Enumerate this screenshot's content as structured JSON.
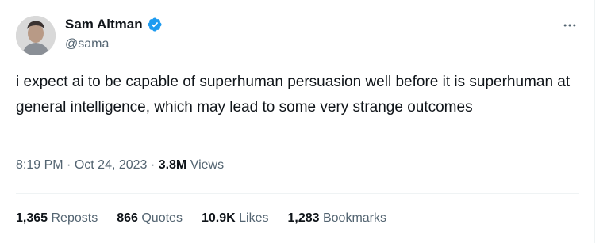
{
  "author": {
    "display_name": "Sam Altman",
    "handle": "@sama",
    "verified_color": "#1d9bf0"
  },
  "tweet": {
    "text": "i expect ai to be capable of superhuman persuasion well before it is superhuman at general intelligence, which may lead to some very strange outcomes",
    "time": "8:19 PM",
    "separator": "·",
    "date": "Oct 24, 2023",
    "views_count": "3.8M",
    "views_label": "Views"
  },
  "stats": {
    "reposts_count": "1,365",
    "reposts_label": "Reposts",
    "quotes_count": "866",
    "quotes_label": "Quotes",
    "likes_count": "10.9K",
    "likes_label": "Likes",
    "bookmarks_count": "1,283",
    "bookmarks_label": "Bookmarks"
  },
  "icons": {
    "more": "more-horizontal-icon",
    "verified": "verified-badge-icon"
  }
}
